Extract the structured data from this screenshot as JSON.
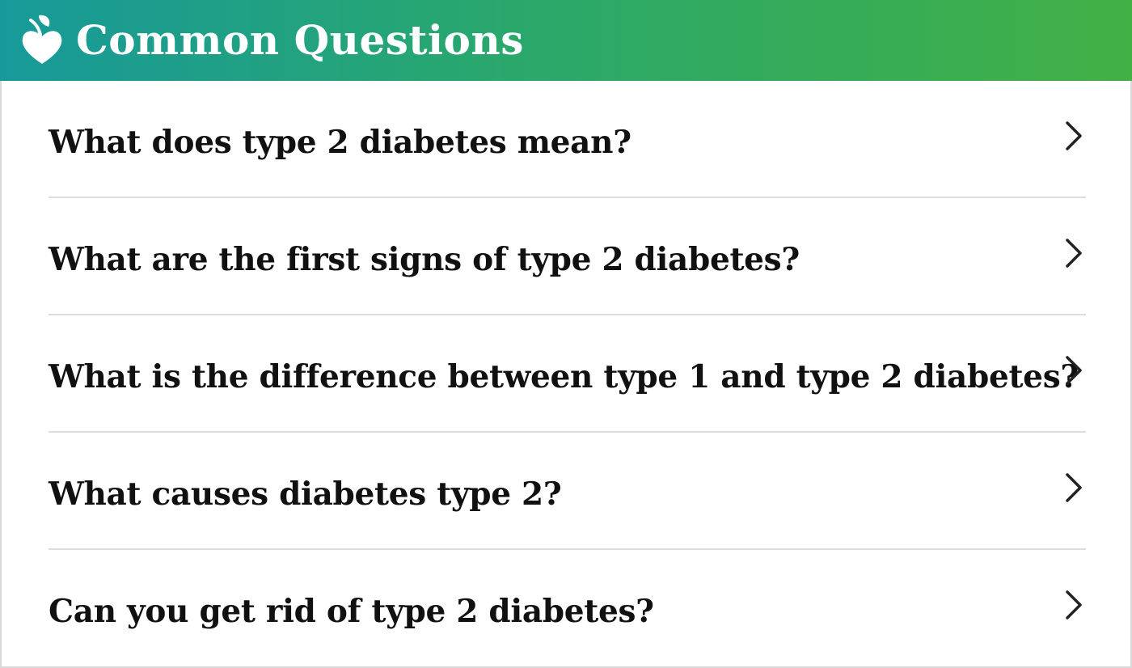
{
  "header": {
    "title": "Common Questions",
    "logo_icon": "apple-heart-icon",
    "gradient": [
      "#17999a",
      "#41b045"
    ]
  },
  "questions": [
    {
      "text": "What does type 2 diabetes mean?",
      "icon": "chevron-right-icon"
    },
    {
      "text": "What are the first signs of type 2 diabetes?",
      "icon": "chevron-right-icon"
    },
    {
      "text": "What is the difference between type 1 and type 2 diabetes?",
      "icon": "chevron-right-icon"
    },
    {
      "text": "What causes diabetes type 2?",
      "icon": "chevron-right-icon"
    },
    {
      "text": "Can you get rid of type 2 diabetes?",
      "icon": "chevron-right-icon"
    }
  ]
}
